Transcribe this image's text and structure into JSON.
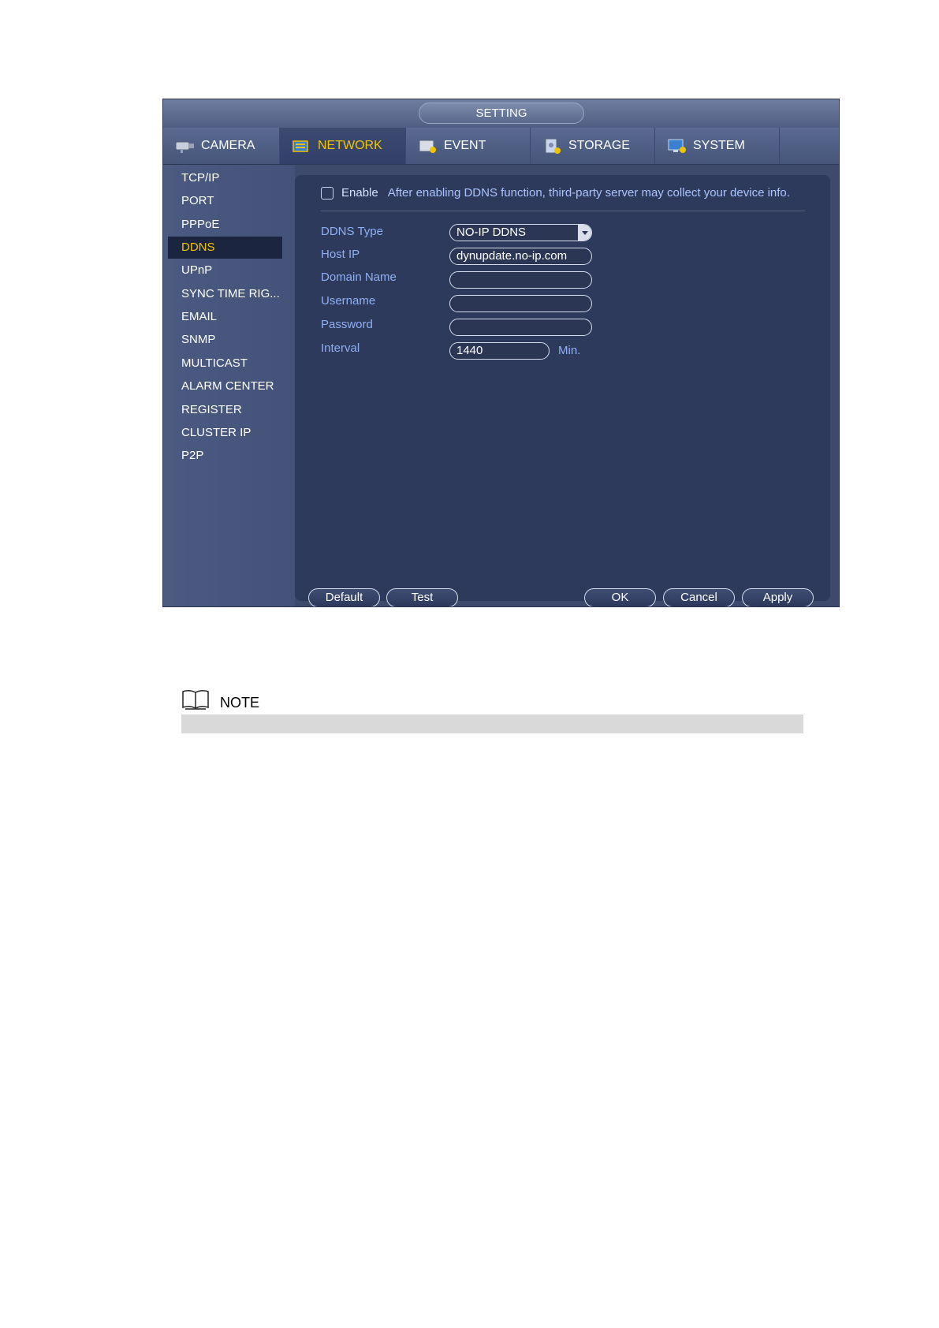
{
  "window": {
    "title": "SETTING"
  },
  "tabs": [
    {
      "label": "CAMERA",
      "icon": "camera-icon",
      "active": false
    },
    {
      "label": "NETWORK",
      "icon": "network-icon",
      "active": true
    },
    {
      "label": "EVENT",
      "icon": "event-icon",
      "active": false
    },
    {
      "label": "STORAGE",
      "icon": "storage-icon",
      "active": false
    },
    {
      "label": "SYSTEM",
      "icon": "system-icon",
      "active": false
    }
  ],
  "sidebar": {
    "items": [
      {
        "label": "TCP/IP"
      },
      {
        "label": "PORT"
      },
      {
        "label": "PPPoE"
      },
      {
        "label": "DDNS",
        "active": true
      },
      {
        "label": "UPnP"
      },
      {
        "label": "SYNC TIME RIG..."
      },
      {
        "label": "EMAIL"
      },
      {
        "label": "SNMP"
      },
      {
        "label": "MULTICAST"
      },
      {
        "label": "ALARM CENTER"
      },
      {
        "label": "REGISTER"
      },
      {
        "label": "CLUSTER IP"
      },
      {
        "label": "P2P"
      }
    ]
  },
  "ddns": {
    "enable_label": "Enable",
    "enable_checked": false,
    "notice": "After enabling DDNS function, third-party server may collect your device info.",
    "type_label": "DDNS Type",
    "type_value": "NO-IP DDNS",
    "host_label": "Host IP",
    "host_value": "dynupdate.no-ip.com",
    "domain_label": "Domain Name",
    "domain_value": "",
    "username_label": "Username",
    "username_value": "",
    "password_label": "Password",
    "password_value": "",
    "interval_label": "Interval",
    "interval_value": "1440",
    "interval_unit": "Min."
  },
  "buttons": {
    "default": "Default",
    "test": "Test",
    "ok": "OK",
    "cancel": "Cancel",
    "apply": "Apply"
  },
  "note": {
    "title": "NOTE"
  },
  "colors": {
    "panel_bg": "#2e3a5c",
    "active_text": "#f0c400",
    "label_text": "#8fb0f5"
  }
}
